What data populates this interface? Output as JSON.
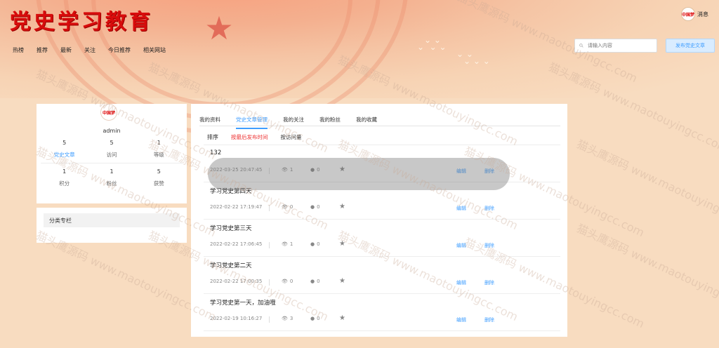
{
  "header": {
    "title": "党史学习教育",
    "nav": [
      "热榜",
      "推荐",
      "最新",
      "关注",
      "今日推荐",
      "相关网站"
    ],
    "search_placeholder": "请输入内容",
    "publish_label": "发布党史文章",
    "message_label": "消息",
    "avatar_text": "中国梦"
  },
  "profile": {
    "avatar_text": "中国梦",
    "username": "admin",
    "stats_row1": [
      {
        "value": "5",
        "label": "党史文章"
      },
      {
        "value": "5",
        "label": "访问"
      },
      {
        "value": "1",
        "label": "等级"
      }
    ],
    "stats_row2": [
      {
        "value": "1",
        "label": "积分"
      },
      {
        "value": "1",
        "label": "粉丝"
      },
      {
        "value": "5",
        "label": "获赞"
      }
    ]
  },
  "category": {
    "title": "分类专栏"
  },
  "tabs": [
    "我的资料",
    "党史文章管理",
    "我的关注",
    "我的粉丝",
    "我的收藏"
  ],
  "active_tab": "党史文章管理",
  "sort": {
    "label": "排序",
    "options": [
      "按最后发布时间",
      "按访问量"
    ]
  },
  "articles": [
    {
      "title": "132",
      "date": "2022-03-25 20:47:45",
      "views": "1",
      "comments": "0",
      "edit": "编辑",
      "delete": "删除"
    },
    {
      "title": "学习党史第四天",
      "date": "2022-02-22 17:19:47",
      "views": "0",
      "comments": "0",
      "edit": "编辑",
      "delete": "删除"
    },
    {
      "title": "学习党史第三天",
      "date": "2022-02-22 17:06:45",
      "views": "1",
      "comments": "0",
      "edit": "编辑",
      "delete": "删除"
    },
    {
      "title": "学习党史第二天",
      "date": "2022-02-22 17:00:35",
      "views": "0",
      "comments": "0",
      "edit": "编辑",
      "delete": "删除"
    },
    {
      "title": "学习党史第一天，加油哦",
      "date": "2022-02-19 10:16:27",
      "views": "3",
      "comments": "0",
      "edit": "编辑",
      "delete": "删除"
    }
  ],
  "watermark": "猫头鹰源码 www.maotouyingcc.com"
}
